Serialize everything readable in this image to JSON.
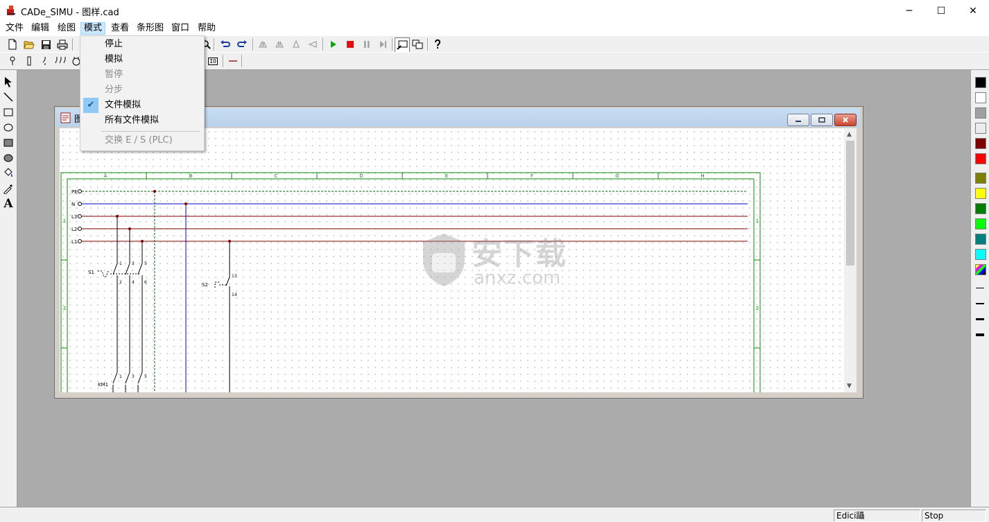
{
  "window": {
    "title": "CADe_SIMU - 图样.cad",
    "minimize": "─",
    "maximize": "☐",
    "close": "✕"
  },
  "menu": {
    "items": [
      "文件",
      "编辑",
      "绘图",
      "模式",
      "查看",
      "条形图",
      "窗口",
      "帮助"
    ],
    "active": "模式"
  },
  "mode_menu": {
    "stop": "停止",
    "simulate": "模拟",
    "pause": "暂停",
    "step": "分步",
    "file_simulation": "文件模拟",
    "all_files_simulation": "所有文件模拟",
    "exchange_io": "交换 E / S (PLC)",
    "checked_item": "文件模拟"
  },
  "toolbar2": {
    "io_label": "IO"
  },
  "child_window": {
    "title_fragment": "图"
  },
  "drawing": {
    "columns": [
      "A",
      "B",
      "C",
      "D",
      "E",
      "F",
      "G",
      "H"
    ],
    "rows": [
      "1",
      "2"
    ],
    "bus_labels": [
      "PE",
      "N",
      "L3",
      "L2",
      "L1"
    ],
    "s1_label": "S1",
    "s2_label": "S2",
    "km1_label": "KM1",
    "s1_top_terminals": [
      "1",
      "3",
      "5"
    ],
    "s1_bottom_terminals": [
      "2",
      "4",
      "6"
    ],
    "s2_terminals": [
      "13",
      "14"
    ],
    "km1_terminals": [
      "1",
      "3",
      "5"
    ]
  },
  "watermark": {
    "text_cn": "安下载",
    "text_url": "anxz.com"
  },
  "statusbar": {
    "mode": "Edici躡",
    "state": "Stop"
  },
  "colors": {
    "palette": [
      "#000000",
      "#ffffff",
      "#a0a0a0",
      "#ececec",
      "#800000",
      "#ff0000",
      "#808000",
      "#ffff00",
      "#008000",
      "#00ff00",
      "#008080",
      "#00ffff"
    ],
    "bus_phase": "#7f0000",
    "bus_neutral": "#0000cc",
    "bus_pe": "#006400",
    "frame": "#0a8a0a",
    "menu_highlight": "#cce8ff"
  }
}
